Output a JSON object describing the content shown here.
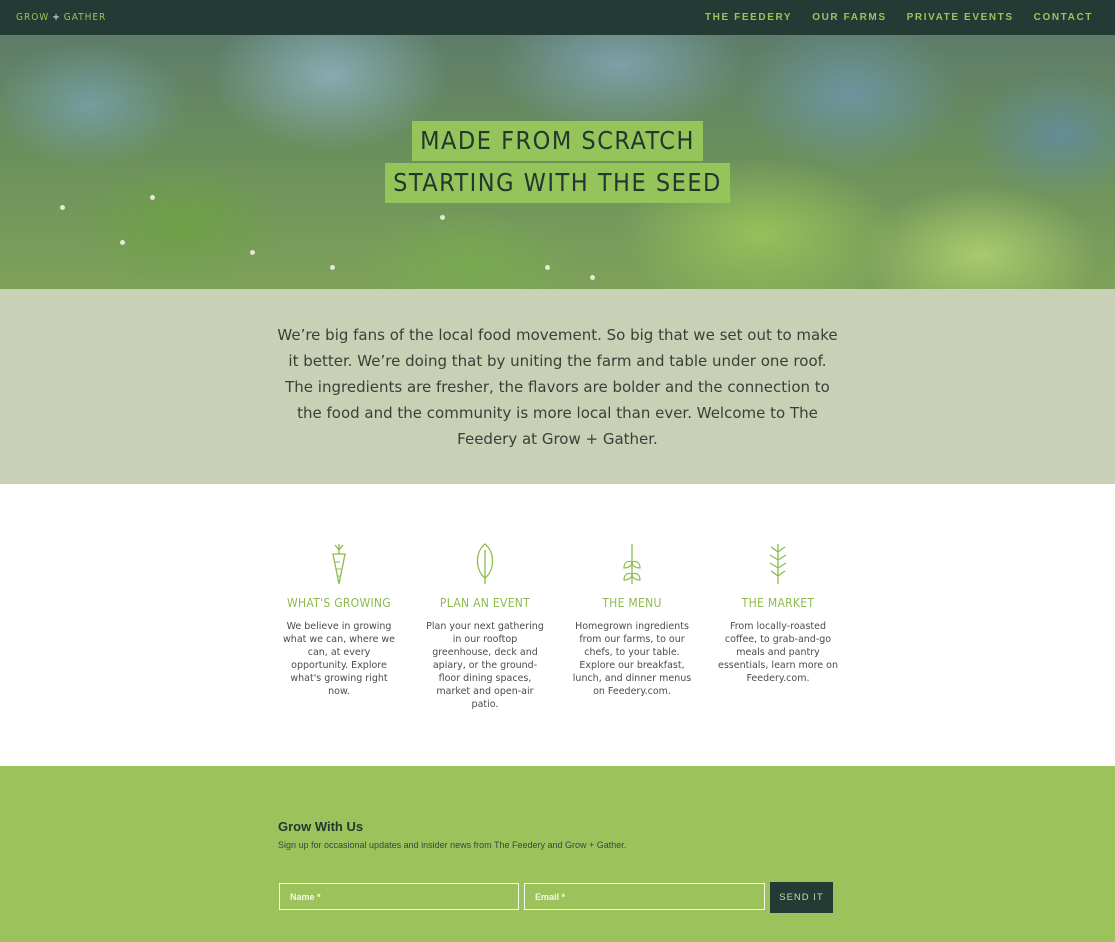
{
  "brand": {
    "logo_left": "GROW",
    "logo_plus": "+",
    "logo_right": "GATHER"
  },
  "nav": {
    "items": [
      {
        "label": "THE FEEDERY"
      },
      {
        "label": "OUR FARMS"
      },
      {
        "label": "PRIVATE EVENTS"
      },
      {
        "label": "CONTACT"
      }
    ]
  },
  "hero": {
    "line1": "MADE FROM SCRATCH",
    "line2": "STARTING WITH THE SEED"
  },
  "intro": {
    "text": "We’re big fans of the local food movement. So big that we set out to make it better. We’re doing that by uniting the farm and table under one roof. The ingredients are fresher, the flavors are bolder and the connection to the food and the community is more local than ever. Welcome to The Feedery at Grow + Gather."
  },
  "features": [
    {
      "icon": "carrot-icon",
      "title": "WHAT'S GROWING",
      "desc": "We believe in growing what we can, where we can, at every opportunity. Explore what's growing right now."
    },
    {
      "icon": "leaf-icon",
      "title": "PLAN AN EVENT",
      "desc": "Plan your next gathering in our rooftop greenhouse, deck and apiary, or the ground-floor dining spaces, market and open-air patio."
    },
    {
      "icon": "sprout-icon",
      "title": "THE MENU",
      "desc": "Homegrown ingredients from our farms, to our chefs, to your table. Explore our breakfast, lunch, and dinner menus on Feedery.com."
    },
    {
      "icon": "wheat-icon",
      "title": "THE MARKET",
      "desc": "From locally-roasted coffee, to grab-and-go meals and pantry essentials, learn more on Feedery.com."
    }
  ],
  "newsletter": {
    "title": "Grow With Us",
    "subtitle": "Sign up for occasional updates and insider news from The Feedery and Grow + Gather.",
    "name_placeholder": "Name *",
    "email_placeholder": "Email *",
    "submit_label": "SEND IT"
  },
  "colors": {
    "nav_bg": "#233a35",
    "accent_green": "#9cc35b",
    "intro_bg": "#c8d0b6"
  }
}
